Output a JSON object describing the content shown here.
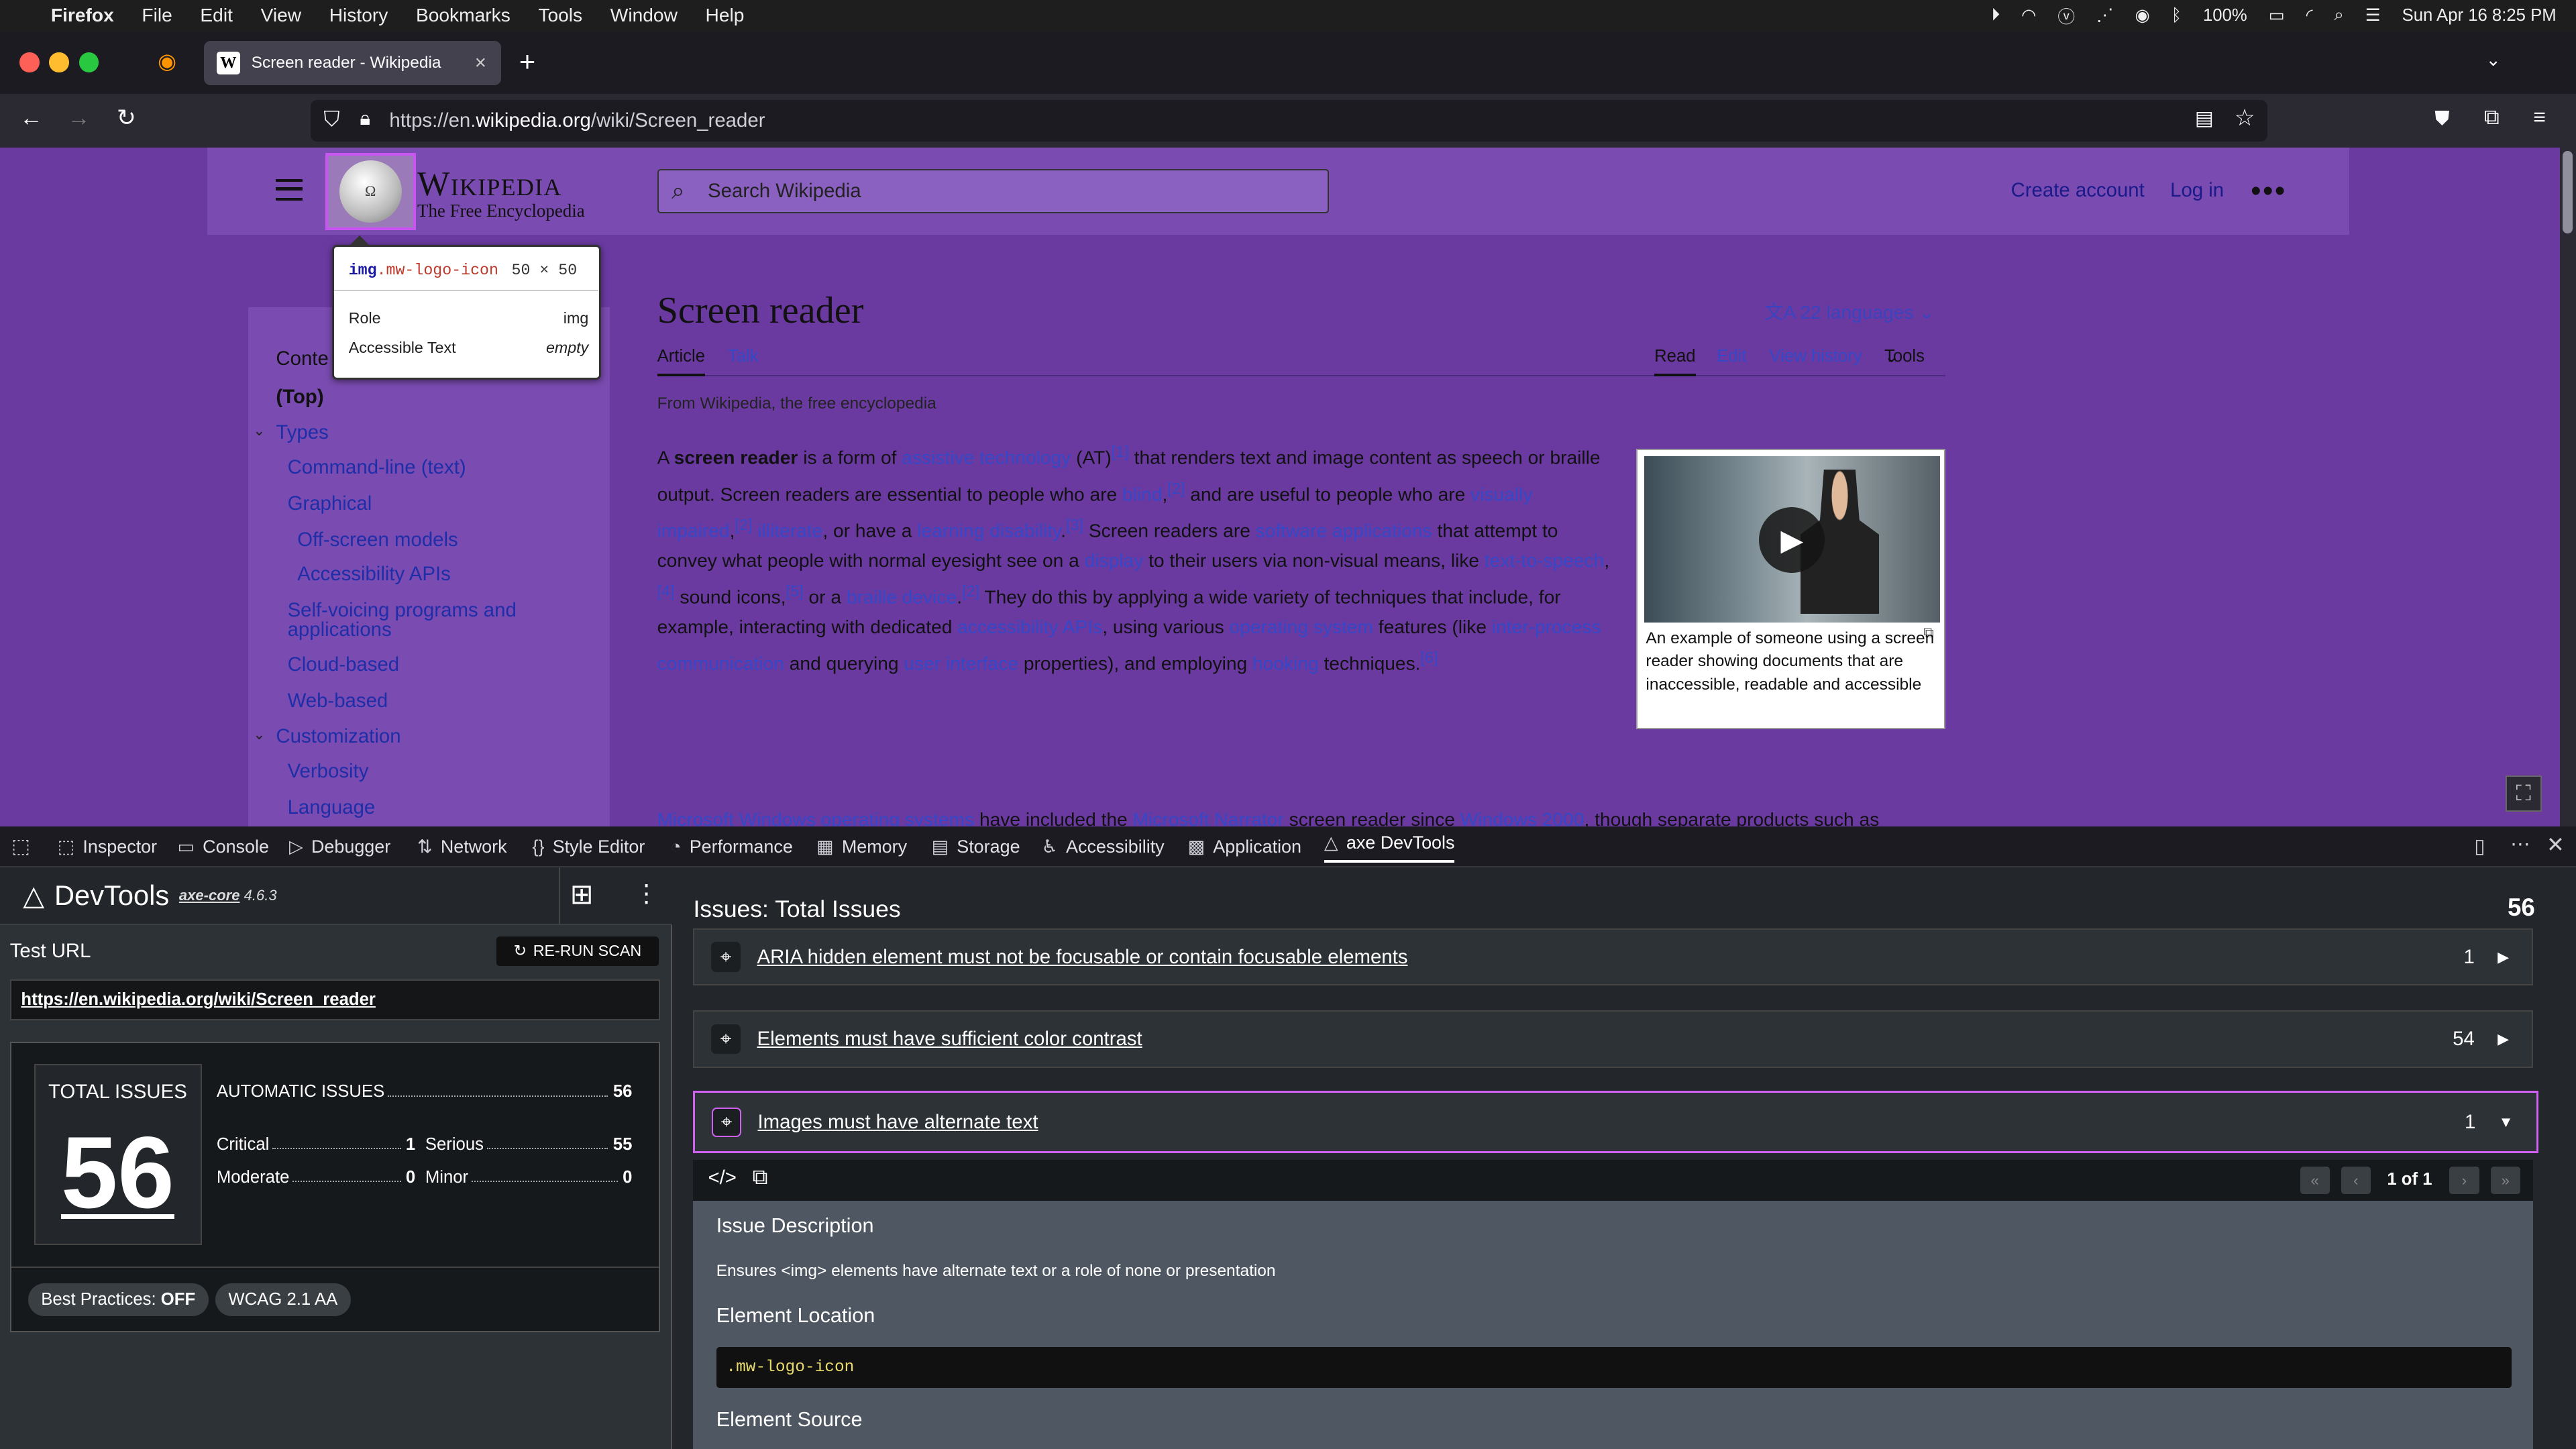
{
  "os": {
    "menu": [
      "Firefox",
      "File",
      "Edit",
      "View",
      "History",
      "Bookmarks",
      "Tools",
      "Window",
      "Help"
    ],
    "battery": "100%",
    "clock": "Sun Apr 16  8:25 PM"
  },
  "browser": {
    "tab_title": "Screen reader - Wikipedia",
    "favicon": "W",
    "url_prefix": "https://en.",
    "url_host": "wikipedia.org",
    "url_path": "/wiki/Screen_reader"
  },
  "wiki": {
    "logo_glyph": "Ω",
    "wordmark": "Wikipedia",
    "tagline": "The Free Encyclopedia",
    "search_placeholder": "Search Wikipedia",
    "create_account": "Create account",
    "log_in": "Log in",
    "more": "•••",
    "title": "Screen reader",
    "languages": "22 languages",
    "tabs": {
      "article": "Article",
      "talk": "Talk",
      "read": "Read",
      "edit": "Edit",
      "history": "View history",
      "tools": "Tools"
    },
    "from": "From Wikipedia, the free encyclopedia",
    "toc_label": "Conte",
    "toc": [
      "(Top)",
      "Types",
      "Command-line (text)",
      "Graphical",
      "Off-screen models",
      "Accessibility APIs",
      "Self-voicing programs and",
      "applications",
      "Cloud-based",
      "Web-based",
      "Customization",
      "Verbosity",
      "Language"
    ],
    "figure_caption": "An example of someone using a screen reader showing documents that are inaccessible, readable and accessible"
  },
  "inspect_tooltip": {
    "tag": "img",
    "cls": ".mw-logo-icon",
    "size": "50 × 50",
    "role_label": "Role",
    "role_value": "img",
    "acc_label": "Accessible Text",
    "acc_value": "empty"
  },
  "devtools_tabs": [
    "Inspector",
    "Console",
    "Debugger",
    "Network",
    "Style Editor",
    "Performance",
    "Memory",
    "Storage",
    "Accessibility",
    "Application",
    "axe DevTools"
  ],
  "axe": {
    "brand": "DevTools",
    "core": "axe-core",
    "version": "4.6.3",
    "test_url_label": "Test URL",
    "rerun": "RE-RUN SCAN",
    "test_url": "https://en.wikipedia.org/wiki/Screen_reader",
    "total_label": "TOTAL ISSUES",
    "total": "56",
    "auto_label": "AUTOMATIC ISSUES",
    "auto": "56",
    "critical_label": "Critical",
    "critical": "1",
    "serious_label": "Serious",
    "serious": "55",
    "moderate_label": "Moderate",
    "moderate": "0",
    "minor_label": "Minor",
    "minor": "0",
    "best_practices_label": "Best Practices:",
    "best_practices_value": "OFF",
    "standard": "WCAG 2.1 AA",
    "issues_heading": "Issues: Total Issues",
    "issues_count": "56",
    "issues": [
      {
        "label": "ARIA hidden element must not be focusable or contain focusable elements",
        "count": "1"
      },
      {
        "label": "Elements must have sufficient color contrast",
        "count": "54"
      },
      {
        "label": "Images must have alternate text",
        "count": "1"
      }
    ],
    "pager": "1 of 1",
    "desc_heading": "Issue Description",
    "desc": "Ensures <img> elements have alternate text or a role of none or presentation",
    "loc_heading": "Element Location",
    "loc": ".mw-logo-icon",
    "src_heading": "Element Source"
  }
}
